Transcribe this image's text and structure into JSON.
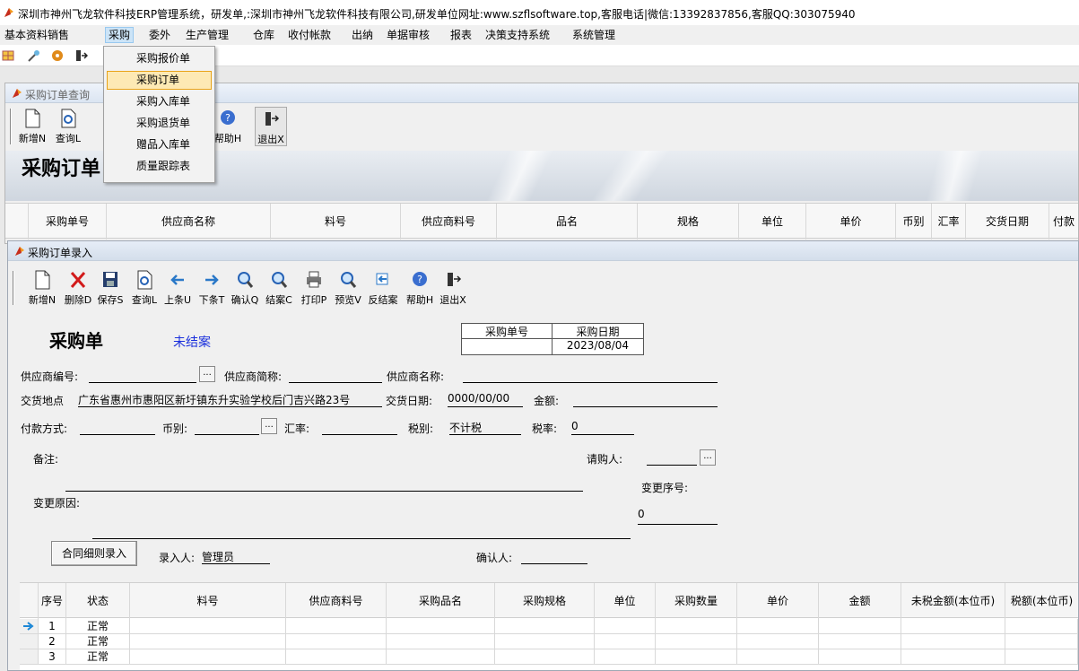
{
  "window_title": "深圳市神州飞龙软件科技ERP管理系统，研发单,:深圳市神州飞龙软件科技有限公司,研发单位网址:www.szflsoftware.top,客服电话|微信:13392837856,客服QQ:303075940",
  "menubar": [
    "基本资料",
    "销售",
    "采购",
    "委外",
    "生产管理",
    "仓库",
    "收付帐款",
    "出纳",
    "单据审核",
    "报表",
    "决策支持系统",
    "系统管理"
  ],
  "dropdown": {
    "items": [
      "采购报价单",
      "采购订单",
      "采购入库单",
      "采购退货单",
      "赠品入库单",
      "质量跟踪表"
    ],
    "selected": "采购订单"
  },
  "query_window": {
    "title": "采购订单查询",
    "toolbar": [
      "新增N",
      "查询L",
      "帮助H",
      "退出X"
    ],
    "banner_title": "采购订单",
    "columns": [
      "采购单号",
      "供应商名称",
      "料号",
      "供应商料号",
      "品名",
      "规格",
      "单位",
      "单价",
      "币别",
      "汇率",
      "交货日期",
      "付款"
    ]
  },
  "entry_window": {
    "title": "采购订单录入",
    "toolbar": [
      "新增N",
      "删除D",
      "保存S",
      "查询L",
      "上条U",
      "下条T",
      "确认Q",
      "结案C",
      "打印P",
      "预览V",
      "反结案",
      "帮助H",
      "退出X"
    ],
    "heading": "采购单",
    "status": "未结案",
    "order_no_label": "采购单号",
    "order_no": "",
    "order_date_label": "采购日期",
    "order_date": "2023/08/04",
    "fields": {
      "supplier_code_label": "供应商编号:",
      "supplier_code": "",
      "supplier_short_label": "供应商简称:",
      "supplier_short": "",
      "supplier_name_label": "供应商名称:",
      "supplier_name": "",
      "delivery_place_label": "交货地点",
      "delivery_place": "广东省惠州市惠阳区新圩镇东升实验学校后门吉兴路23号",
      "delivery_date_label": "交货日期:",
      "delivery_date": "0000/00/00",
      "amount_label": "金额:",
      "amount": "",
      "payment_label": "付款方式:",
      "payment": "",
      "currency_label": "币别:",
      "currency": "",
      "rate_label": "汇率:",
      "rate": "",
      "tax_type_label": "税别:",
      "tax_type": "不计税",
      "tax_rate_label": "税率:",
      "tax_rate": "0",
      "note_label": "备注:",
      "requester_label": "请购人:",
      "requester": "",
      "change_no_label": "变更序号:",
      "change_no": "0",
      "change_reason_label": "变更原因:",
      "contract_button": "合同细则录入",
      "entered_by_label": "录入人:",
      "entered_by": "管理员",
      "confirmed_by_label": "确认人:",
      "confirmed_by": ""
    },
    "grid_columns": [
      "序号",
      "状态",
      "料号",
      "供应商料号",
      "采购品名",
      "采购规格",
      "单位",
      "采购数量",
      "单价",
      "金额",
      "未税金额(本位币)",
      "税额(本位币)"
    ],
    "rows": [
      {
        "no": "1",
        "status": "正常"
      },
      {
        "no": "2",
        "status": "正常"
      },
      {
        "no": "3",
        "status": "正常"
      }
    ]
  }
}
